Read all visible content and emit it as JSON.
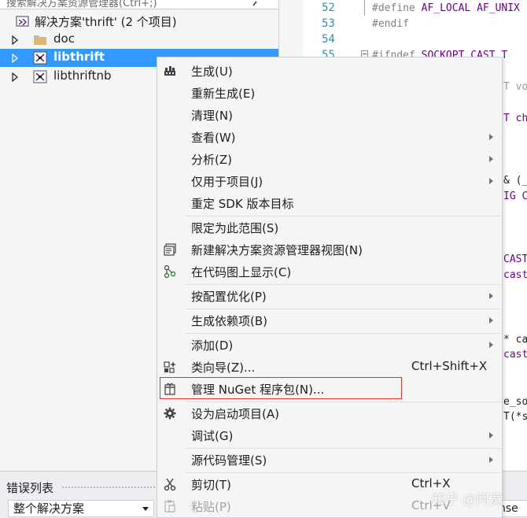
{
  "solution_explorer": {
    "search_placeholder": "搜索解决方案资源管理器(Ctrl+;)",
    "solution_label": "解决方案'thrift' (2 个项目)",
    "items": [
      {
        "label": "doc",
        "icon": "folder-icon"
      },
      {
        "label": "libthrift",
        "icon": "cpp-project-icon",
        "selected": true
      },
      {
        "label": "libthriftnb",
        "icon": "cpp-project-icon"
      }
    ]
  },
  "code_editor": {
    "line_numbers": [
      "52",
      "53",
      "54",
      "55"
    ],
    "lines": [
      {
        "kw": "#define",
        "rest": " AF_LOCAL AF_UNIX"
      },
      {
        "kw": "#endif",
        "rest": ""
      },
      {
        "kw": "",
        "rest": ""
      },
      {
        "kw": "#ifndef",
        "rest": " SOCKOPT_CAST_T"
      }
    ],
    "fragments": [
      "T vo",
      "T ch",
      "& (_",
      "IG C",
      "CAST",
      "cast",
      "* ca",
      "cast",
      "e_so",
      "T(*s"
    ]
  },
  "context_menu": {
    "items": [
      {
        "label": "生成(U)",
        "icon": "build-icon"
      },
      {
        "label": "重新生成(E)"
      },
      {
        "label": "清理(N)"
      },
      {
        "label": "查看(W)",
        "submenu": true
      },
      {
        "label": "分析(Z)",
        "submenu": true
      },
      {
        "label": "仅用于项目(J)",
        "submenu": true
      },
      {
        "label": "重定 SDK 版本目标"
      },
      {
        "label": "限定为此范围(S)"
      },
      {
        "label": "新建解决方案资源管理器视图(N)",
        "icon": "new-view-icon"
      },
      {
        "label": "在代码图上显示(C)",
        "icon": "code-map-icon"
      },
      {
        "label": "按配置优化(P)",
        "submenu": true
      },
      {
        "label": "生成依赖项(B)",
        "submenu": true
      },
      {
        "label": "添加(D)",
        "submenu": true
      },
      {
        "label": "类向导(Z)...",
        "shortcut": "Ctrl+Shift+X",
        "icon": "class-wizard-icon"
      },
      {
        "label": "管理 NuGet 程序包(N)...",
        "icon": "nuget-package-icon"
      },
      {
        "label": "设为启动项目(A)",
        "icon": "gear-icon"
      },
      {
        "label": "调试(G)",
        "submenu": true
      },
      {
        "label": "源代码管理(S)",
        "submenu": true
      },
      {
        "label": "剪切(T)",
        "shortcut": "Ctrl+X",
        "icon": "scissors-icon"
      },
      {
        "label": "粘贴(P)",
        "shortcut": "Ctrl+V",
        "icon": "paste-icon",
        "disabled": true
      }
    ]
  },
  "bottom_panel": {
    "title": "错误列表",
    "scope_value": "整个解决方案",
    "partial_text": "nse"
  },
  "watermark": "知乎 @阿宽",
  "colors": {
    "selection": "#3399ff",
    "highlight_box": "#e03030",
    "line_number": "#2b91af",
    "macro": "#6f008a"
  }
}
